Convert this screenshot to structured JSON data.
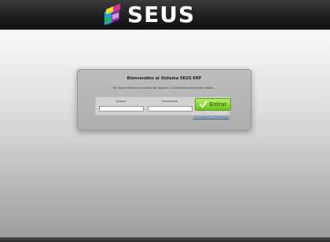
{
  "header": {
    "brand": "SEUS"
  },
  "login": {
    "title": "Bienvenidos al Sistema SEUS ERP",
    "subtitle": "Por favor introduce los datos de Usuario y Contraseña para iniciar sesión...",
    "usuario_label": "Usuario",
    "usuario_value": "",
    "password_label": "Contraseña",
    "password_value": "",
    "submit_label": "Entrar",
    "forgot_label": "¿Olvidaste tu contraseña?"
  },
  "colors": {
    "header_bg": "#1a1a1a",
    "button_green": "#88d636",
    "link_blue": "#2b5fa8"
  },
  "icons": {
    "logo": "books-logo-icon",
    "submit": "checkmark-icon"
  }
}
